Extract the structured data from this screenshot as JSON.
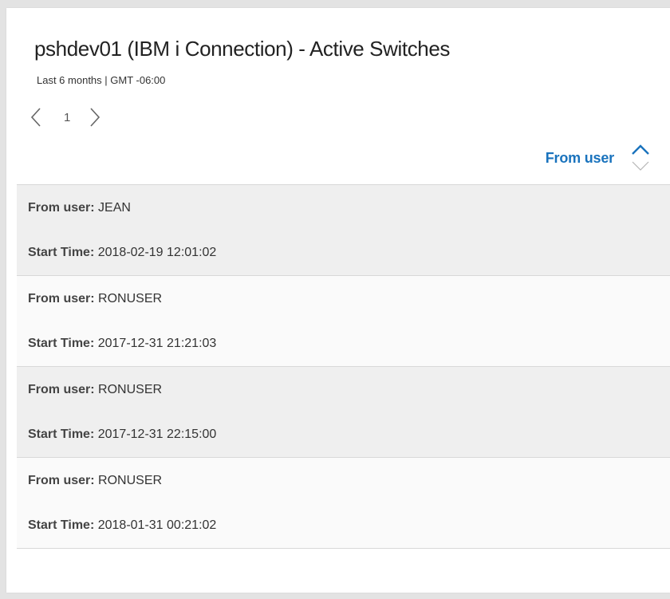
{
  "widget": {
    "title": "pshdev01 (IBM i Connection) - Active Switches",
    "subtitle": "Last 6 months | GMT -06:00"
  },
  "pager": {
    "current_page": "1",
    "prev_icon": "chevron-left-icon",
    "next_icon": "chevron-right-icon"
  },
  "sort": {
    "label": "From user",
    "icon": "sort-toggle-icon",
    "accent_color": "#1a73bd"
  },
  "field_labels": {
    "from_user": "From user:",
    "start_time": "Start Time:"
  },
  "records": [
    {
      "from_user": "JEAN",
      "start_time": "2018-02-19 12:01:02"
    },
    {
      "from_user": "RONUSER",
      "start_time": "2017-12-31 21:21:03"
    },
    {
      "from_user": "RONUSER",
      "start_time": "2017-12-31 22:15:00"
    },
    {
      "from_user": "RONUSER",
      "start_time": "2018-01-31 00:21:02"
    }
  ]
}
